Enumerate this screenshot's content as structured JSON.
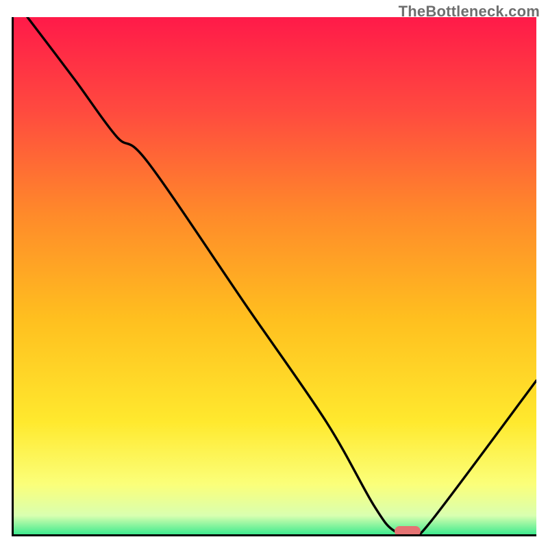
{
  "watermark": "TheBottleneck.com",
  "chart_data": {
    "type": "line",
    "title": "",
    "xlabel": "",
    "ylabel": "",
    "xlim": [
      0,
      100
    ],
    "ylim": [
      0,
      100
    ],
    "x": [
      3,
      12,
      20,
      26,
      45,
      60,
      69,
      73,
      77,
      80,
      100
    ],
    "values": [
      100,
      88,
      77,
      72,
      44,
      22,
      6,
      1,
      1,
      3,
      30
    ],
    "gradient_stops": [
      {
        "offset": 0,
        "color": "#ff1a49"
      },
      {
        "offset": 18,
        "color": "#ff4a3f"
      },
      {
        "offset": 38,
        "color": "#ff8a2a"
      },
      {
        "offset": 58,
        "color": "#ffbf1f"
      },
      {
        "offset": 78,
        "color": "#ffe92e"
      },
      {
        "offset": 90,
        "color": "#fbff7a"
      },
      {
        "offset": 96,
        "color": "#d9ffb0"
      },
      {
        "offset": 100,
        "color": "#2ee88b"
      }
    ],
    "marker": {
      "x_start": 73,
      "x_end": 78,
      "y": 0.5,
      "color": "#e57373"
    },
    "curve_color": "#000000",
    "axis_color": "#000000"
  }
}
